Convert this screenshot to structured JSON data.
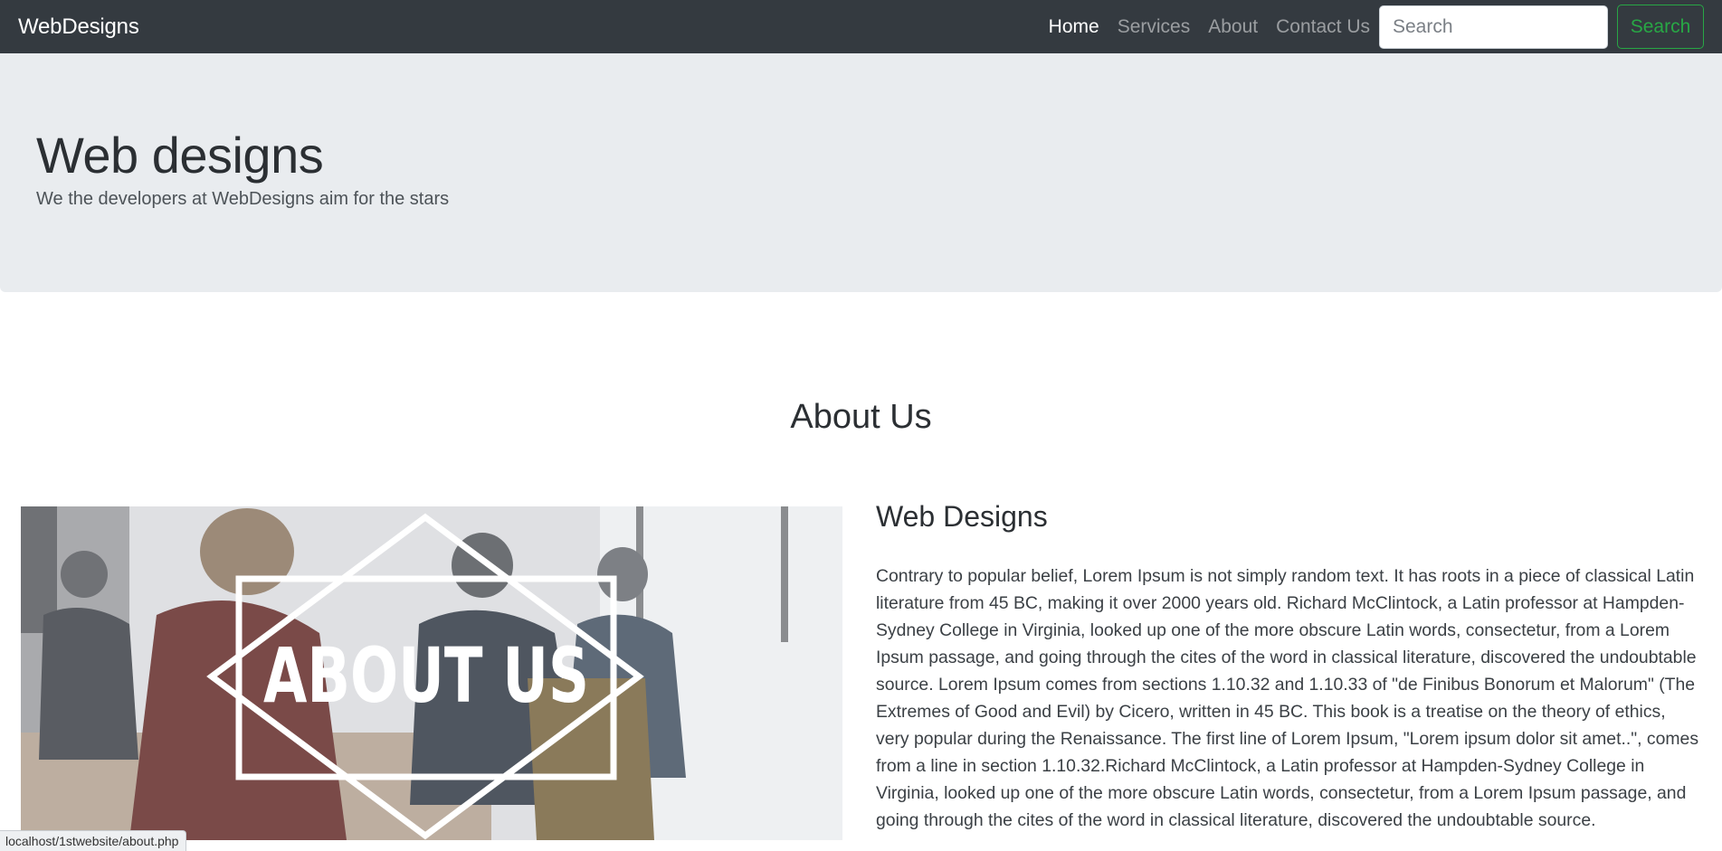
{
  "navbar": {
    "brand": "WebDesigns",
    "links": [
      {
        "label": "Home",
        "active": true
      },
      {
        "label": "Services",
        "active": false
      },
      {
        "label": "About",
        "active": false
      },
      {
        "label": "Contact Us",
        "active": false
      }
    ],
    "search": {
      "placeholder": "Search",
      "value": ""
    },
    "search_button_label": "Search"
  },
  "jumbotron": {
    "title": "Web designs",
    "lead": "We the developers at WebDesigns aim for the stars"
  },
  "about": {
    "section_title": "About Us",
    "image_caption": "ABOUT US",
    "heading": "Web Designs",
    "body": "Contrary to popular belief, Lorem Ipsum is not simply random text. It has roots in a piece of classical Latin literature from 45 BC, making it over 2000 years old. Richard McClintock, a Latin professor at Hampden-Sydney College in Virginia, looked up one of the more obscure Latin words, consectetur, from a Lorem Ipsum passage, and going through the cites of the word in classical literature, discovered the undoubtable source. Lorem Ipsum comes from sections 1.10.32 and 1.10.33 of \"de Finibus Bonorum et Malorum\" (The Extremes of Good and Evil) by Cicero, written in 45 BC. This book is a treatise on the theory of ethics, very popular during the Renaissance. The first line of Lorem Ipsum, \"Lorem ipsum dolor sit amet..\", comes from a line in section 1.10.32.Richard McClintock, a Latin professor at Hampden-Sydney College in Virginia, looked up one of the more obscure Latin words, consectetur, from a Lorem Ipsum passage, and going through the cites of the word in classical literature, discovered the undoubtable source."
  },
  "status_bar": {
    "url": "localhost/1stwebsite/about.php"
  },
  "colors": {
    "navbar_bg": "#343a40",
    "jumbotron_bg": "#e9ecef",
    "accent_green": "#28a745"
  }
}
